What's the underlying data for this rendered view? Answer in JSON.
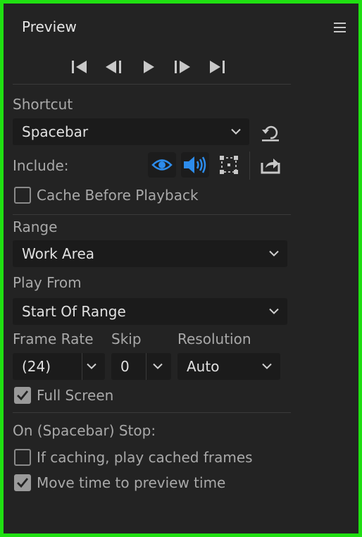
{
  "panel": {
    "title": "Preview",
    "menu_icon": "hamburger-menu-icon"
  },
  "transport": [
    {
      "name": "go-to-first-frame",
      "icon": "first-frame-icon"
    },
    {
      "name": "previous-frame",
      "icon": "previous-frame-icon"
    },
    {
      "name": "play",
      "icon": "play-icon"
    },
    {
      "name": "next-frame",
      "icon": "next-frame-icon"
    },
    {
      "name": "go-to-last-frame",
      "icon": "last-frame-icon"
    }
  ],
  "shortcut": {
    "label": "Shortcut",
    "value": "Spacebar",
    "reset_icon": "reset-icon"
  },
  "include": {
    "label": "Include:",
    "video_icon": "eye-icon",
    "audio_icon": "speaker-icon",
    "overlays_icon": "overlays-icon",
    "export_icon": "export-icon",
    "active_color": "#2d8ceb"
  },
  "cache_before_playback": {
    "label": "Cache Before Playback",
    "checked": false
  },
  "range": {
    "label": "Range",
    "value": "Work Area"
  },
  "play_from": {
    "label": "Play From",
    "value": "Start Of Range"
  },
  "frame_rate": {
    "label": "Frame Rate",
    "value": "(24)"
  },
  "skip": {
    "label": "Skip",
    "value": "0"
  },
  "resolution": {
    "label": "Resolution",
    "value": "Auto"
  },
  "full_screen": {
    "label": "Full Screen",
    "checked": true
  },
  "stop": {
    "label": "On (Spacebar) Stop:",
    "if_caching": {
      "label": "If caching, play cached frames",
      "checked": false
    },
    "move_time": {
      "label": "Move time to preview time",
      "checked": true
    }
  }
}
